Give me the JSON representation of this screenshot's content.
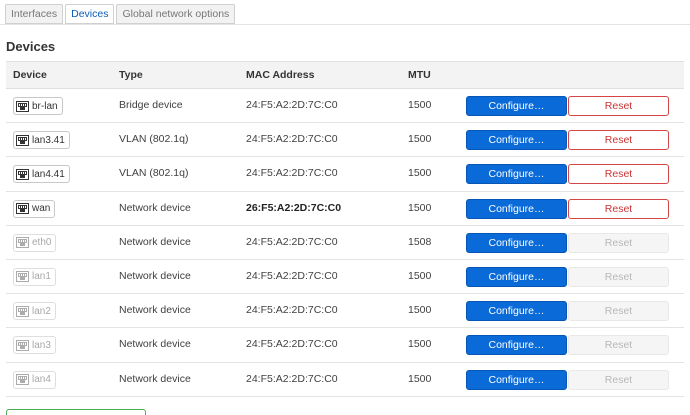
{
  "tabs": [
    {
      "label": "Interfaces",
      "active": false
    },
    {
      "label": "Devices",
      "active": true
    },
    {
      "label": "Global network options",
      "active": false
    }
  ],
  "page_title": "Devices",
  "table": {
    "headers": {
      "device": "Device",
      "type": "Type",
      "mac": "MAC Address",
      "mtu": "MTU"
    },
    "rows": [
      {
        "device": "br-lan",
        "type": "Bridge device",
        "mac": "24:F5:A2:2D:7C:C0",
        "mtu": "1500",
        "configure": "Configure…",
        "reset": "Reset",
        "reset_enabled": true,
        "dim": false,
        "mac_bold": false
      },
      {
        "device": "lan3.41",
        "type": "VLAN (802.1q)",
        "mac": "24:F5:A2:2D:7C:C0",
        "mtu": "1500",
        "configure": "Configure…",
        "reset": "Reset",
        "reset_enabled": true,
        "dim": false,
        "mac_bold": false
      },
      {
        "device": "lan4.41",
        "type": "VLAN (802.1q)",
        "mac": "24:F5:A2:2D:7C:C0",
        "mtu": "1500",
        "configure": "Configure…",
        "reset": "Reset",
        "reset_enabled": true,
        "dim": false,
        "mac_bold": false
      },
      {
        "device": "wan",
        "type": "Network device",
        "mac": "26:F5:A2:2D:7C:C0",
        "mtu": "1500",
        "configure": "Configure…",
        "reset": "Reset",
        "reset_enabled": true,
        "dim": false,
        "mac_bold": true
      },
      {
        "device": "eth0",
        "type": "Network device",
        "mac": "24:F5:A2:2D:7C:C0",
        "mtu": "1508",
        "configure": "Configure…",
        "reset": "Reset",
        "reset_enabled": false,
        "dim": true,
        "mac_bold": false
      },
      {
        "device": "lan1",
        "type": "Network device",
        "mac": "24:F5:A2:2D:7C:C0",
        "mtu": "1500",
        "configure": "Configure…",
        "reset": "Reset",
        "reset_enabled": false,
        "dim": true,
        "mac_bold": false
      },
      {
        "device": "lan2",
        "type": "Network device",
        "mac": "24:F5:A2:2D:7C:C0",
        "mtu": "1500",
        "configure": "Configure…",
        "reset": "Reset",
        "reset_enabled": false,
        "dim": true,
        "mac_bold": false
      },
      {
        "device": "lan3",
        "type": "Network device",
        "mac": "24:F5:A2:2D:7C:C0",
        "mtu": "1500",
        "configure": "Configure…",
        "reset": "Reset",
        "reset_enabled": false,
        "dim": true,
        "mac_bold": false
      },
      {
        "device": "lan4",
        "type": "Network device",
        "mac": "24:F5:A2:2D:7C:C0",
        "mtu": "1500",
        "configure": "Configure…",
        "reset": "Reset",
        "reset_enabled": false,
        "dim": true,
        "mac_bold": false
      }
    ]
  },
  "device_icon": "ethernet-port-icon",
  "colors": {
    "accent": "#0a6ad8",
    "reset": "#d64545",
    "add": "#4caf50"
  }
}
